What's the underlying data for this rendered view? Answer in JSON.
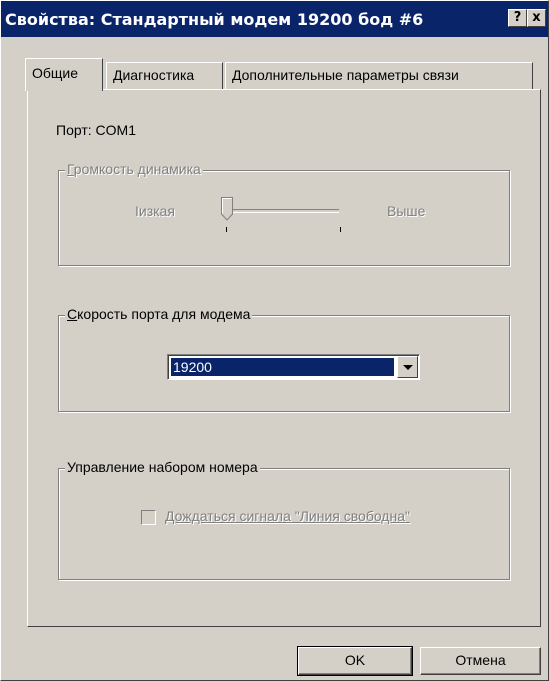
{
  "window": {
    "title": "Свойства: Стандартный модем 19200 бод #6",
    "help_button": "?",
    "close_button": "x"
  },
  "tabs": [
    {
      "label": "Общие",
      "active": true
    },
    {
      "label": "Диагностика",
      "active": false
    },
    {
      "label": "Дополнительные параметры связи",
      "active": false
    }
  ],
  "general": {
    "port_label": "Порт:",
    "port_value": "COM1"
  },
  "volume": {
    "legend_first": "Г",
    "legend_rest": "ромкость динамика",
    "low_label": "Iизкая",
    "high_label": "Выше",
    "level": 0,
    "enabled": false
  },
  "speed": {
    "legend_first": "С",
    "legend_rest": "корость порта для модема",
    "selected": "19200"
  },
  "dialing": {
    "legend": "Управление набором номера",
    "checkbox_label": "Дождаться сигнала \"Линия свободна\"",
    "checked": false,
    "enabled": false
  },
  "buttons": {
    "ok": "OK",
    "cancel": "Отмена"
  },
  "colors": {
    "face": "#d4d0c8",
    "titlebar": "#0a246a",
    "selection": "#0a246a",
    "disabled_text": "#808080"
  }
}
